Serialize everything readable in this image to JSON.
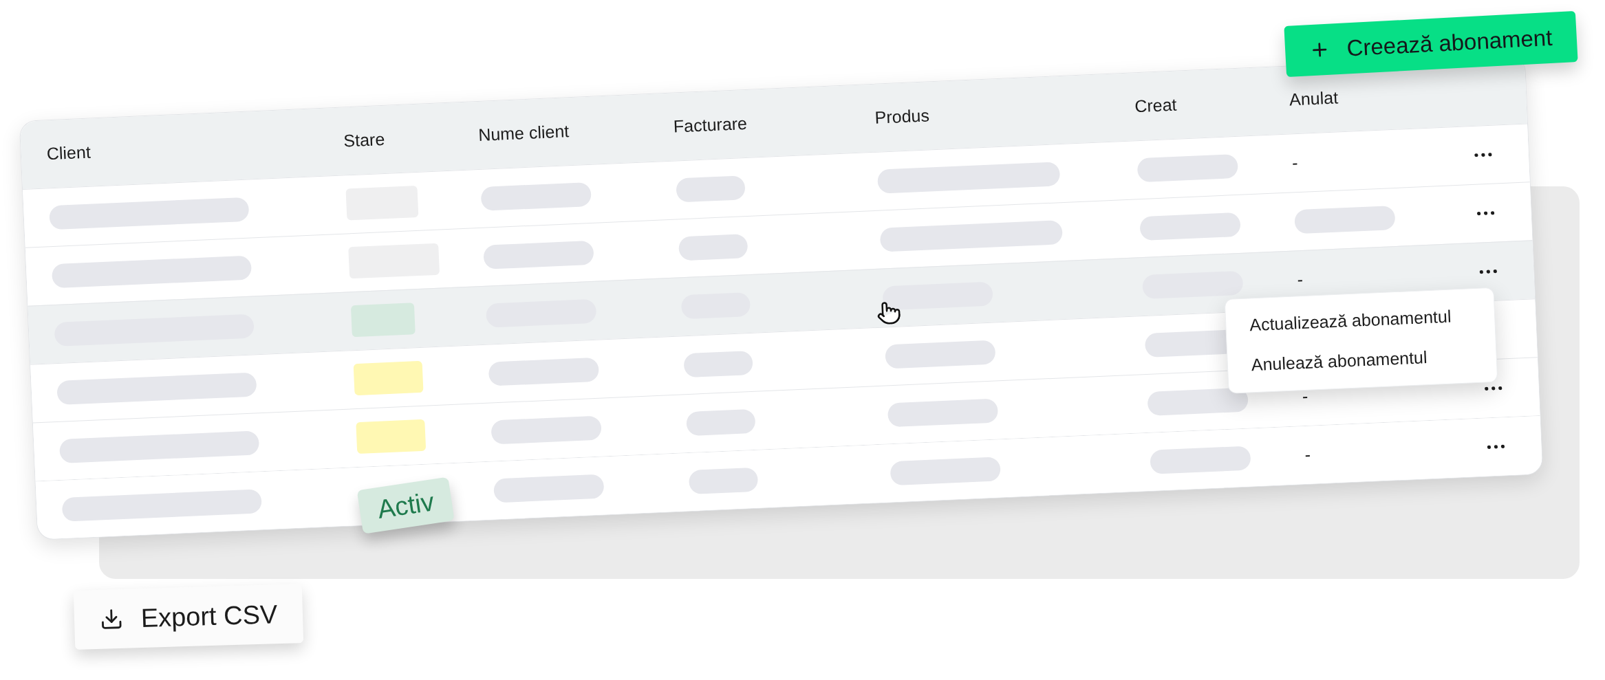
{
  "create_button": {
    "label": "Creează abonament"
  },
  "table": {
    "columns": [
      "Client",
      "Stare",
      "Nume client",
      "Facturare",
      "Produs",
      "Creat",
      "Anulat"
    ],
    "rows": [
      {
        "selected": false,
        "status": {
          "kind": "swatch",
          "color": "#efeff0"
        },
        "anulat": {
          "kind": "text",
          "text": "-"
        },
        "actions": true
      },
      {
        "selected": false,
        "status": {
          "kind": "swatch",
          "color": "#efeff0"
        },
        "anulat": {
          "kind": "placeholder"
        },
        "actions": true
      },
      {
        "selected": true,
        "status": {
          "kind": "swatch",
          "color": "#d6eadf"
        },
        "anulat": {
          "kind": "text",
          "text": "-"
        },
        "actions": true,
        "menu": {
          "items": [
            "Actualizează abonamentul",
            "Anulează abonamentul"
          ]
        }
      },
      {
        "selected": false,
        "status": {
          "kind": "swatch",
          "color": "#fff8b3"
        },
        "actions": false
      },
      {
        "selected": false,
        "status": {
          "kind": "swatch",
          "color": "#fff8b3"
        },
        "anulat": {
          "kind": "text",
          "text": "-"
        },
        "actions": true
      },
      {
        "selected": false,
        "status": {
          "kind": "badge",
          "label": "Activ",
          "color": "#d6eadf"
        },
        "anulat": {
          "kind": "text",
          "text": "-"
        },
        "actions": true
      }
    ]
  },
  "export_button": {
    "label": "Export CSV"
  }
}
